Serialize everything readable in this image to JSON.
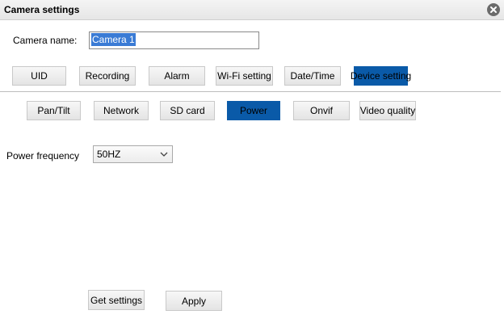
{
  "window": {
    "title": "Camera settings",
    "close_icon": "close-icon"
  },
  "camera": {
    "label": "Camera name:",
    "value": "Camera 1"
  },
  "main_tabs": [
    {
      "label": "UID"
    },
    {
      "label": "Recording"
    },
    {
      "label": "Alarm"
    },
    {
      "label": "Wi-Fi setting"
    },
    {
      "label": "Date/Time"
    },
    {
      "label": "Device setting",
      "active": true
    }
  ],
  "sub_tabs": [
    {
      "label": "Pan/Tilt"
    },
    {
      "label": "Network"
    },
    {
      "label": "SD card"
    },
    {
      "label": "Power",
      "active": true
    },
    {
      "label": "Onvif"
    },
    {
      "label": "Video quality"
    }
  ],
  "power": {
    "label": "Power frequency",
    "selected": "50HZ"
  },
  "actions": {
    "get_settings": "Get settings",
    "apply": "Apply"
  },
  "colors": {
    "accent": "#0a5aa8",
    "selection": "#3a7bd5"
  }
}
